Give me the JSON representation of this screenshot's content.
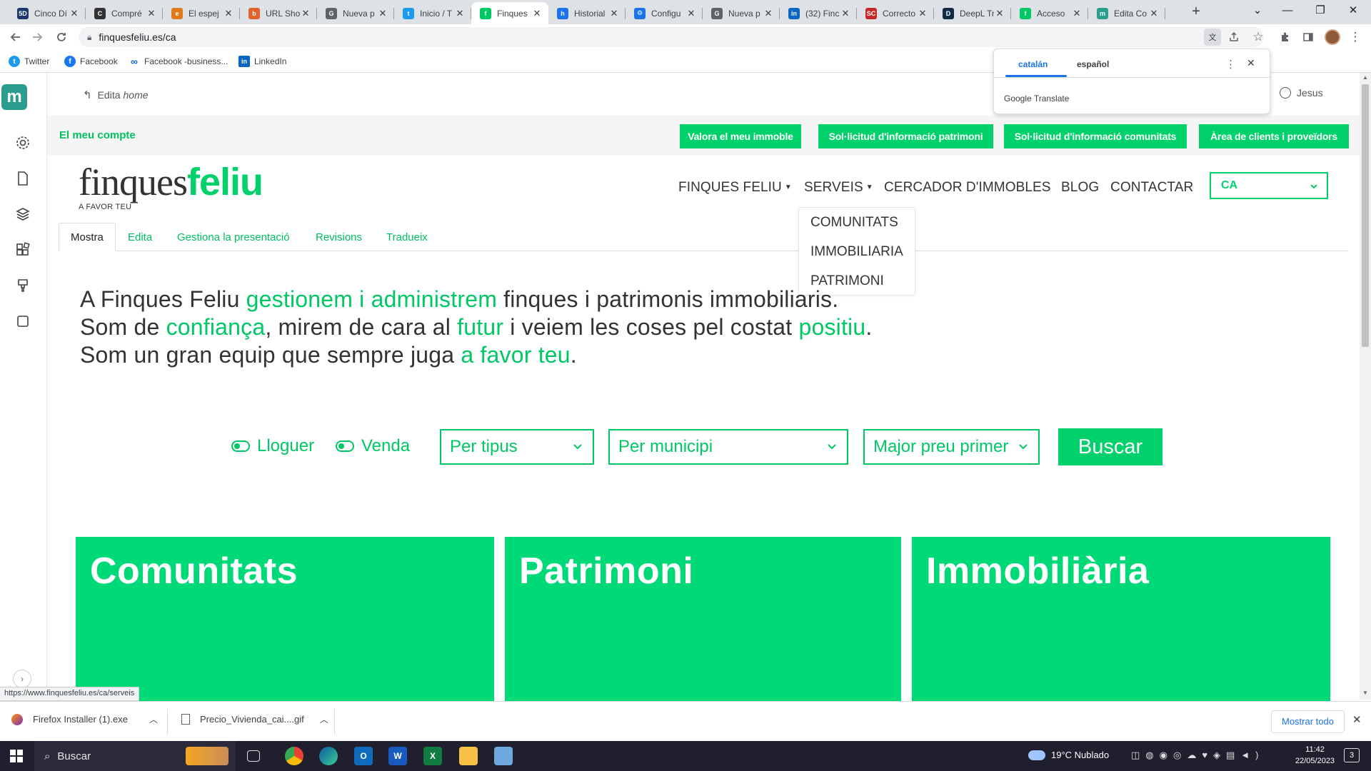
{
  "browser": {
    "tabs": [
      {
        "title": "Cinco Dí",
        "fav": "5D",
        "color": "#1a3a6b"
      },
      {
        "title": "Compré",
        "fav": "C",
        "color": "#333333"
      },
      {
        "title": "El espej",
        "fav": "e",
        "color": "#e07b1a"
      },
      {
        "title": "URL Sho",
        "fav": "b",
        "color": "#e0632a"
      },
      {
        "title": "Nueva p",
        "fav": "G",
        "color": "#5f6368"
      },
      {
        "title": "Inicio / T",
        "fav": "t",
        "color": "#1d9bf0"
      },
      {
        "title": "Finques",
        "fav": "f",
        "color": "#00c865"
      },
      {
        "title": "Historial",
        "fav": "h",
        "color": "#1a73e8"
      },
      {
        "title": "Configu",
        "fav": "⚙",
        "color": "#1a73e8"
      },
      {
        "title": "Nueva p",
        "fav": "G",
        "color": "#5f6368"
      },
      {
        "title": "(32) Finc",
        "fav": "in",
        "color": "#0a66c2"
      },
      {
        "title": "Correcto",
        "fav": "SC",
        "color": "#c62828"
      },
      {
        "title": "DeepL Tr",
        "fav": "D",
        "color": "#0f2b46"
      },
      {
        "title": "Acceso",
        "fav": "f",
        "color": "#00c865"
      },
      {
        "title": "Edita Co",
        "fav": "m",
        "color": "#2a9d8f"
      }
    ],
    "close_glyph": "✕",
    "new_tab": "+",
    "url": "finquesfeliu.es/ca",
    "window_controls": [
      "⌄",
      "—",
      "❐",
      "✕"
    ]
  },
  "bookmarks": [
    {
      "label": "Twitter",
      "icon": "twitter-icon",
      "color": "#1d9bf0",
      "glyph": "t"
    },
    {
      "label": "Facebook",
      "icon": "facebook-icon",
      "color": "#1877f2",
      "glyph": "f"
    },
    {
      "label": "Facebook -business...",
      "icon": "meta-icon",
      "color": "#0668e1",
      "glyph": "∞"
    },
    {
      "label": "LinkedIn",
      "icon": "linkedin-icon",
      "color": "#0a66c2",
      "glyph": "in"
    }
  ],
  "translate_popup": {
    "lang_active": "catalán",
    "lang_other": "español",
    "brand": "Google",
    "brand_suffix": "Translate"
  },
  "cms": {
    "back_label": "Edita",
    "back_page": "home",
    "user": "Jesus",
    "logo_letter": "m",
    "tabs": [
      "Mostra",
      "Edita",
      "Gestiona la presentació",
      "Revisions",
      "Tradueix"
    ]
  },
  "site": {
    "my_account": "El meu compte",
    "top_buttons": [
      "Valora el meu immoble",
      "Sol·licitud d'informació patrimoni",
      "Sol·licitud d'informació comunitats",
      "Àrea de clients i proveïdors"
    ],
    "logo_light": "finques",
    "logo_bold": "feliu",
    "tagline": "A FAVOR TEU",
    "nav": [
      "FINQUES FELIU",
      "SERVEIS",
      "CERCADOR D'IMMOBLES",
      "BLOG",
      "CONTACTAR"
    ],
    "lang": "CA",
    "dropdown": [
      "COMUNITATS",
      "IMMOBILIARIA",
      "PATRIMONI"
    ],
    "hero": {
      "l1a": "A Finques Feliu ",
      "l1b": "gestionem i administrem",
      "l1c": " finques i patrimonis immobiliaris.",
      "l2a": "Som de ",
      "l2b": "confiança",
      "l2c": ", mirem de cara al ",
      "l2d": "futur",
      "l2e": " i veiem les coses pel costat ",
      "l2f": "positiu",
      "l2g": ".",
      "l3a": "Som un gran equip que sempre juga ",
      "l3b": "a favor teu",
      "l3c": "."
    },
    "search": {
      "toggle_rent": "Lloguer",
      "toggle_sale": "Venda",
      "by_type": "Per tipus",
      "by_town": "Per municipi",
      "sort": "Major preu primer",
      "submit": "Buscar"
    },
    "cards": [
      "Comunitats",
      "Patrimoni",
      "Immobiliària"
    ]
  },
  "status_url": "https://www.finquesfeliu.es/ca/serveis",
  "downloads": {
    "items": [
      "Firefox Installer (1).exe",
      "Precio_Vivienda_cai....gif"
    ],
    "show_all": "Mostrar todo"
  },
  "taskbar": {
    "search": "Buscar",
    "weather": "19°C  Nublado",
    "time": "11:42",
    "date": "22/05/2023",
    "notif": "3"
  },
  "colors": {
    "brand_green": "#00d16a",
    "card_green": "#00d977"
  }
}
